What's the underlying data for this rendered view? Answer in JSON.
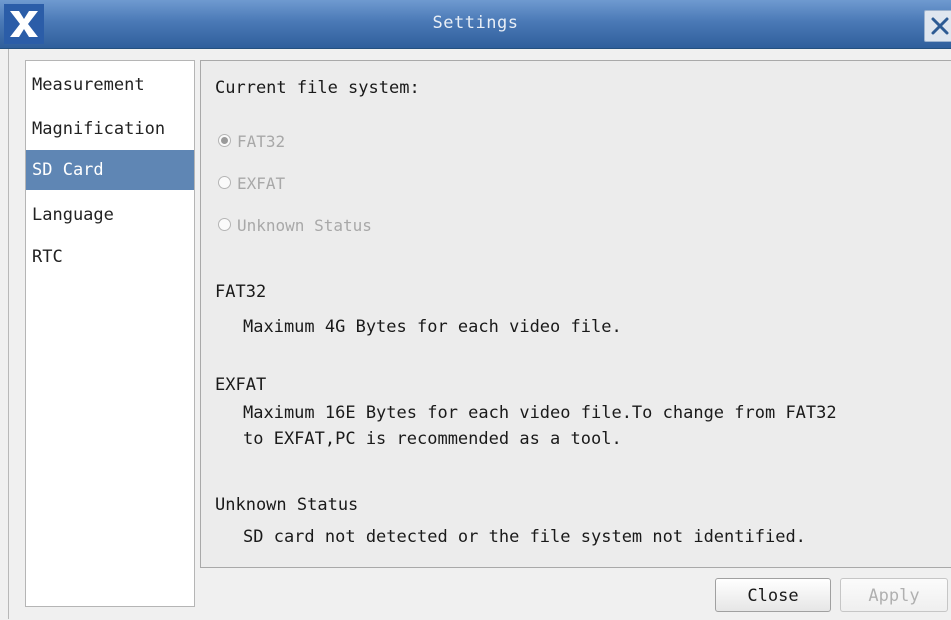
{
  "window": {
    "title": "Settings",
    "icons": {
      "app": "x-logo-icon",
      "close": "close-icon"
    }
  },
  "sidebar": {
    "items": [
      {
        "label": "Measurement",
        "active": false
      },
      {
        "label": "Magnification",
        "active": false
      },
      {
        "label": "SD Card",
        "active": true
      },
      {
        "label": "Language",
        "active": false
      },
      {
        "label": "RTC",
        "active": false
      }
    ]
  },
  "sd_card": {
    "current_label": "Current file system:",
    "options": [
      {
        "label": "FAT32",
        "checked": true,
        "disabled": true
      },
      {
        "label": "EXFAT",
        "checked": false,
        "disabled": true
      },
      {
        "label": "Unknown Status",
        "checked": false,
        "disabled": true
      }
    ],
    "info": {
      "fat32": {
        "heading": "FAT32",
        "text": "Maximum 4G Bytes for each video file."
      },
      "exfat": {
        "heading": "EXFAT",
        "line1": "Maximum 16E Bytes for each video file.To change from FAT32",
        "line2": "to EXFAT,PC is recommended as a tool."
      },
      "unknown": {
        "heading": "Unknown Status",
        "text": "SD card not detected or the file system not identified."
      }
    }
  },
  "buttons": {
    "close": "Close",
    "apply": "Apply"
  },
  "colors": {
    "titlebar": "#4a79b6",
    "selection": "#5f86b4"
  }
}
